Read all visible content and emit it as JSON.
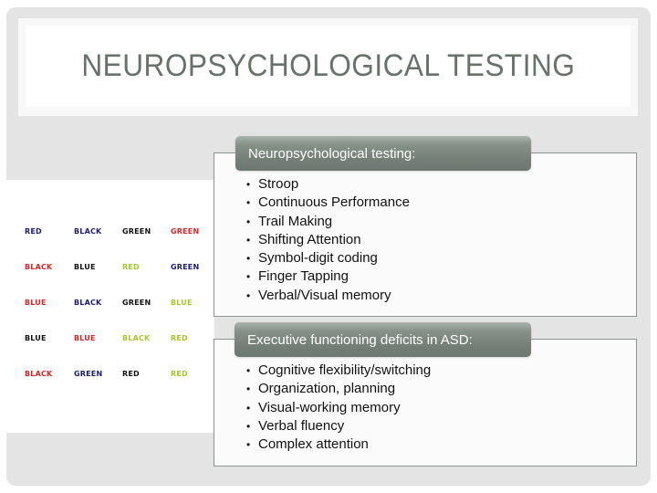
{
  "slide": {
    "title": "NEUROPSYCHOLOGICAL TESTING"
  },
  "stroop_image": {
    "description": "Stroop test color-word grid",
    "colors": {
      "navy": "#1c1c70",
      "black": "#111111",
      "red": "#e02424",
      "green": "#a6c62e"
    },
    "rows": [
      [
        {
          "word": "RED",
          "ink": "navy"
        },
        {
          "word": "BLACK",
          "ink": "navy"
        },
        {
          "word": "GREEN",
          "ink": "black"
        },
        {
          "word": "GREEN",
          "ink": "red"
        }
      ],
      [
        {
          "word": "BLACK",
          "ink": "red"
        },
        {
          "word": "BLUE",
          "ink": "black"
        },
        {
          "word": "RED",
          "ink": "green"
        },
        {
          "word": "GREEN",
          "ink": "navy"
        }
      ],
      [
        {
          "word": "BLUE",
          "ink": "red"
        },
        {
          "word": "BLACK",
          "ink": "navy"
        },
        {
          "word": "GREEN",
          "ink": "black"
        },
        {
          "word": "BLUE",
          "ink": "green"
        }
      ],
      [
        {
          "word": "BLUE",
          "ink": "black"
        },
        {
          "word": "BLUE",
          "ink": "red"
        },
        {
          "word": "BLACK",
          "ink": "green"
        },
        {
          "word": "RED",
          "ink": "green"
        }
      ],
      [
        {
          "word": "BLACK",
          "ink": "red"
        },
        {
          "word": "GREEN",
          "ink": "navy"
        },
        {
          "word": "RED",
          "ink": "black"
        },
        {
          "word": "RED",
          "ink": "green"
        }
      ]
    ]
  },
  "sections": [
    {
      "header": "Neuropsychological testing:",
      "items": [
        "Stroop",
        "Continuous Performance",
        "Trail Making",
        "Shifting Attention",
        "Symbol-digit coding",
        "Finger Tapping",
        "Verbal/Visual memory"
      ]
    },
    {
      "header": "Executive functioning deficits in ASD:",
      "items": [
        "Cognitive flexibility/switching",
        "Organization, planning",
        "Visual-working memory",
        "Verbal fluency",
        "Complex attention"
      ]
    }
  ]
}
